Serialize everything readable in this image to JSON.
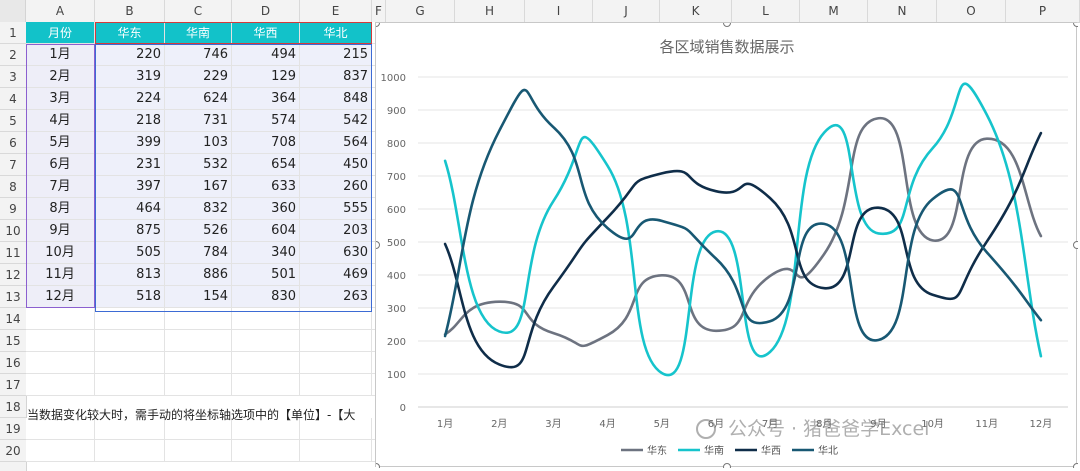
{
  "sheet": {
    "columns": [
      "A",
      "B",
      "C",
      "D",
      "E",
      "F",
      "G",
      "H",
      "I",
      "J",
      "K",
      "L",
      "M",
      "N",
      "O",
      "P"
    ],
    "rows": [
      "1",
      "2",
      "3",
      "4",
      "5",
      "6",
      "7",
      "8",
      "9",
      "10",
      "11",
      "12",
      "13",
      "14",
      "15",
      "16",
      "17",
      "18",
      "19",
      "20"
    ],
    "headers": [
      "月份",
      "华东",
      "华南",
      "华西",
      "华北"
    ],
    "data": [
      [
        "1月",
        "220",
        "746",
        "494",
        "215"
      ],
      [
        "2月",
        "319",
        "229",
        "129",
        "837"
      ],
      [
        "3月",
        "224",
        "624",
        "364",
        "848"
      ],
      [
        "4月",
        "218",
        "731",
        "574",
        "542"
      ],
      [
        "5月",
        "399",
        "103",
        "708",
        "564"
      ],
      [
        "6月",
        "231",
        "532",
        "654",
        "450"
      ],
      [
        "7月",
        "397",
        "167",
        "633",
        "260"
      ],
      [
        "8月",
        "464",
        "832",
        "360",
        "555"
      ],
      [
        "9月",
        "875",
        "526",
        "604",
        "203"
      ],
      [
        "10月",
        "505",
        "784",
        "340",
        "630"
      ],
      [
        "11月",
        "813",
        "886",
        "501",
        "469"
      ],
      [
        "12月",
        "518",
        "154",
        "830",
        "263"
      ]
    ],
    "note": "当数据变化较大时，需手动的将坐标轴选项中的【单位】-【大"
  },
  "watermark": "公众号 · 猪爸爸学Excel",
  "colors": {
    "header_bg": "#12c2c9",
    "华东": "#6d7380",
    "华南": "#16c4cc",
    "华西": "#0f2d49",
    "华北": "#185873"
  },
  "chart_data": {
    "type": "line",
    "smooth": true,
    "title": "各区域销售数据展示",
    "categories": [
      "1月",
      "2月",
      "3月",
      "4月",
      "5月",
      "6月",
      "7月",
      "8月",
      "9月",
      "10月",
      "11月",
      "12月"
    ],
    "ylim": [
      0,
      1000
    ],
    "yticks": [
      "0",
      "100",
      "200",
      "300",
      "400",
      "500",
      "600",
      "700",
      "800",
      "900",
      "1000"
    ],
    "grid": true,
    "legend": "bottom",
    "series": [
      {
        "name": "华东",
        "color": "#6d7380",
        "values": [
          220,
          319,
          224,
          218,
          399,
          231,
          397,
          464,
          875,
          505,
          813,
          518
        ]
      },
      {
        "name": "华南",
        "color": "#16c4cc",
        "values": [
          746,
          229,
          624,
          731,
          103,
          532,
          167,
          832,
          526,
          784,
          886,
          154
        ]
      },
      {
        "name": "华西",
        "color": "#0f2d49",
        "values": [
          494,
          129,
          364,
          574,
          708,
          654,
          633,
          360,
          604,
          340,
          501,
          830
        ]
      },
      {
        "name": "华北",
        "color": "#185873",
        "values": [
          215,
          837,
          848,
          542,
          564,
          450,
          260,
          555,
          203,
          630,
          469,
          263
        ]
      }
    ]
  }
}
